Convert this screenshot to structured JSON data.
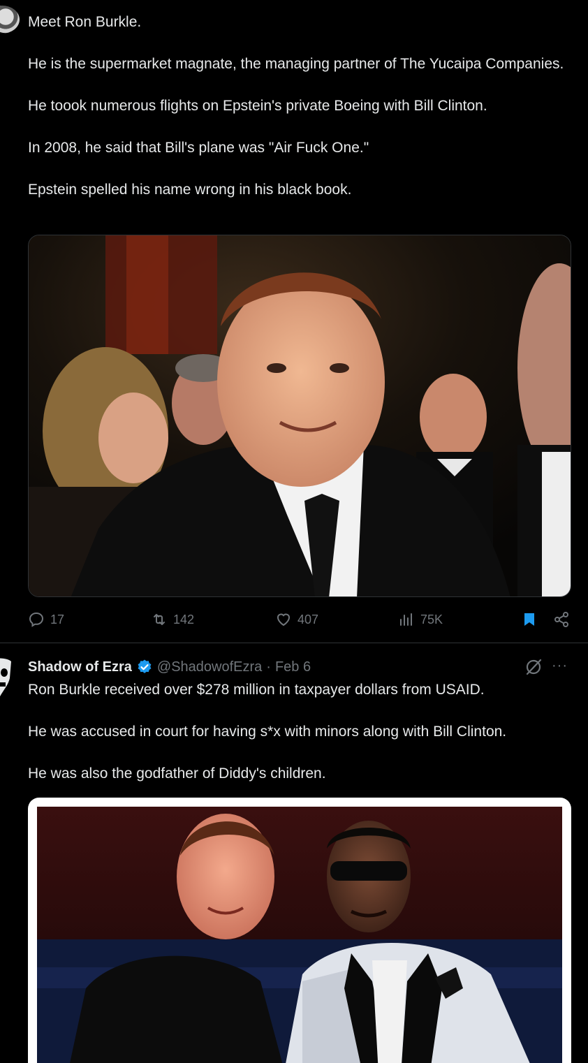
{
  "tweet1": {
    "paragraphs": [
      "Meet Ron Burkle.",
      "He is the supermarket magnate, the managing partner of The Yucaipa Companies.",
      "He toook numerous flights on Epstein's private Boeing with Bill Clinton.",
      "In 2008, he said that Bill's plane was \"Air Fuck One.\"",
      "Epstein spelled his name wrong in his black book."
    ],
    "stats": {
      "replies": "17",
      "reposts": "142",
      "likes": "407",
      "views": "75K"
    }
  },
  "tweet2": {
    "author_name": "Shadow of Ezra",
    "handle": "@ShadowofEzra",
    "separator": "·",
    "date": "Feb 6",
    "more": "···",
    "paragraphs": [
      "Ron Burkle received over $278 million in taxpayer dollars from USAID.",
      "He was accused in court for having s*x with minors along with Bill Clinton.",
      "He was also the godfather of Diddy's children."
    ]
  },
  "colors": {
    "background": "#000000",
    "text": "#e7e9ea",
    "muted": "#71767b",
    "accent": "#1d9bf0",
    "divider": "#2f3336"
  },
  "icons": [
    "reply-icon",
    "repost-icon",
    "like-icon",
    "views-icon",
    "bookmark-icon",
    "share-icon",
    "verified-icon",
    "grok-icon",
    "more-icon"
  ]
}
